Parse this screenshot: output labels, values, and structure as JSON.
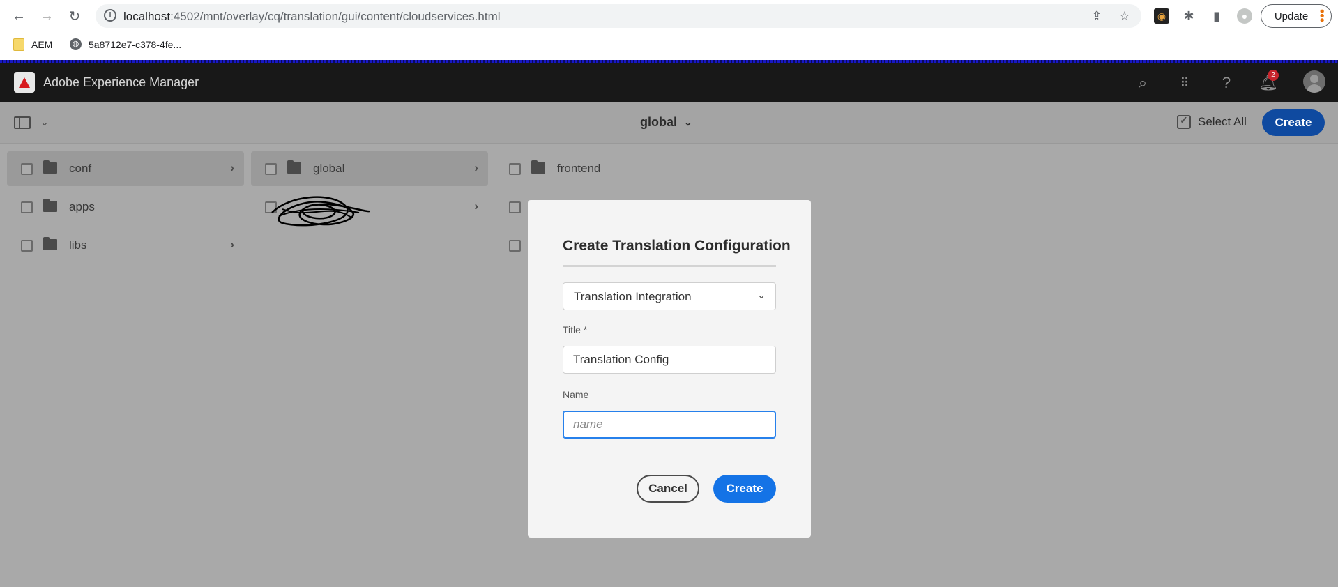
{
  "browser": {
    "url_host": "localhost",
    "url_path": ":4502/mnt/overlay/cq/translation/gui/content/cloudservices.html",
    "update_label": "Update",
    "bookmarks": [
      {
        "label": "AEM"
      },
      {
        "label": "5a8712e7-c378-4fe..."
      }
    ]
  },
  "shell": {
    "title": "Adobe Experience Manager",
    "notification_count": "2"
  },
  "actionbar": {
    "breadcrumb": "global",
    "select_all_label": "Select All",
    "create_label": "Create"
  },
  "columns": {
    "col1": [
      {
        "label": "conf"
      },
      {
        "label": "apps"
      },
      {
        "label": "libs"
      }
    ],
    "col2": [
      {
        "label": "global"
      }
    ],
    "col3": [
      {
        "label": "frontend"
      }
    ]
  },
  "dialog": {
    "title": "Create Translation Configuration",
    "type_select_value": "Translation Integration",
    "title_field_label": "Title *",
    "title_field_value": "Translation Config",
    "name_field_label": "Name",
    "name_field_placeholder": "name",
    "cancel_label": "Cancel",
    "create_label": "Create"
  }
}
